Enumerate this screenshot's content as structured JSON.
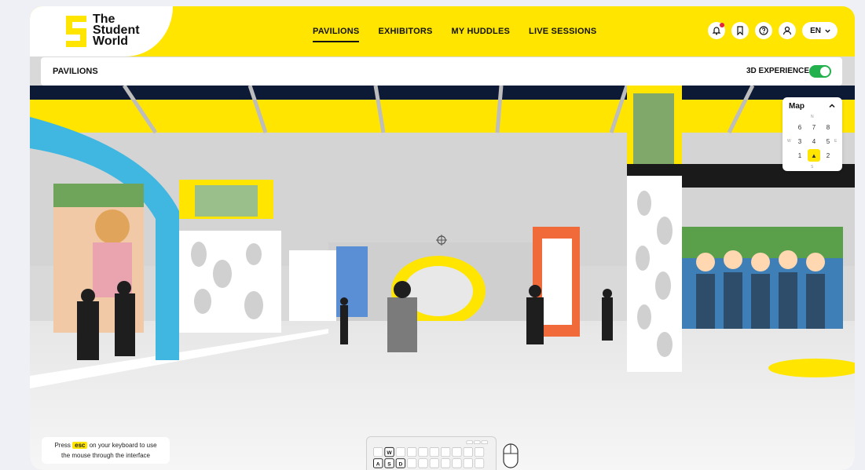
{
  "app": {
    "logo_lines": [
      "The",
      "Student",
      "World"
    ],
    "colors": {
      "brand_yellow": "#ffe500",
      "toggle_on": "#23b14d",
      "notification": "#e4233f"
    }
  },
  "nav": {
    "items": [
      {
        "label": "PAVILIONS",
        "active": true
      },
      {
        "label": "EXHIBITORS",
        "active": false
      },
      {
        "label": "MY HUDDLES",
        "active": false
      },
      {
        "label": "LIVE SESSIONS",
        "active": false
      }
    ]
  },
  "header_actions": {
    "icons": [
      "bell-icon",
      "bookmark-icon",
      "help-icon",
      "user-icon"
    ],
    "language": "EN"
  },
  "subbar": {
    "title": "PAVILIONS",
    "experience_label": "3D EXPERIENCE",
    "experience_on": true
  },
  "map": {
    "title": "Map",
    "compass": {
      "n": "N",
      "s": "S",
      "w": "W",
      "e": "E"
    },
    "cells": [
      [
        "6",
        "7",
        "8"
      ],
      [
        "3",
        "4",
        "5"
      ],
      [
        "1",
        "",
        "2"
      ]
    ],
    "current_marker": "▲"
  },
  "hint": {
    "prefix": "Press",
    "key": "esc",
    "suffix": "on your keyboard to use",
    "line2": "the mouse through the interface"
  },
  "keyboard": {
    "keys": [
      "W",
      "A",
      "S",
      "D"
    ]
  }
}
